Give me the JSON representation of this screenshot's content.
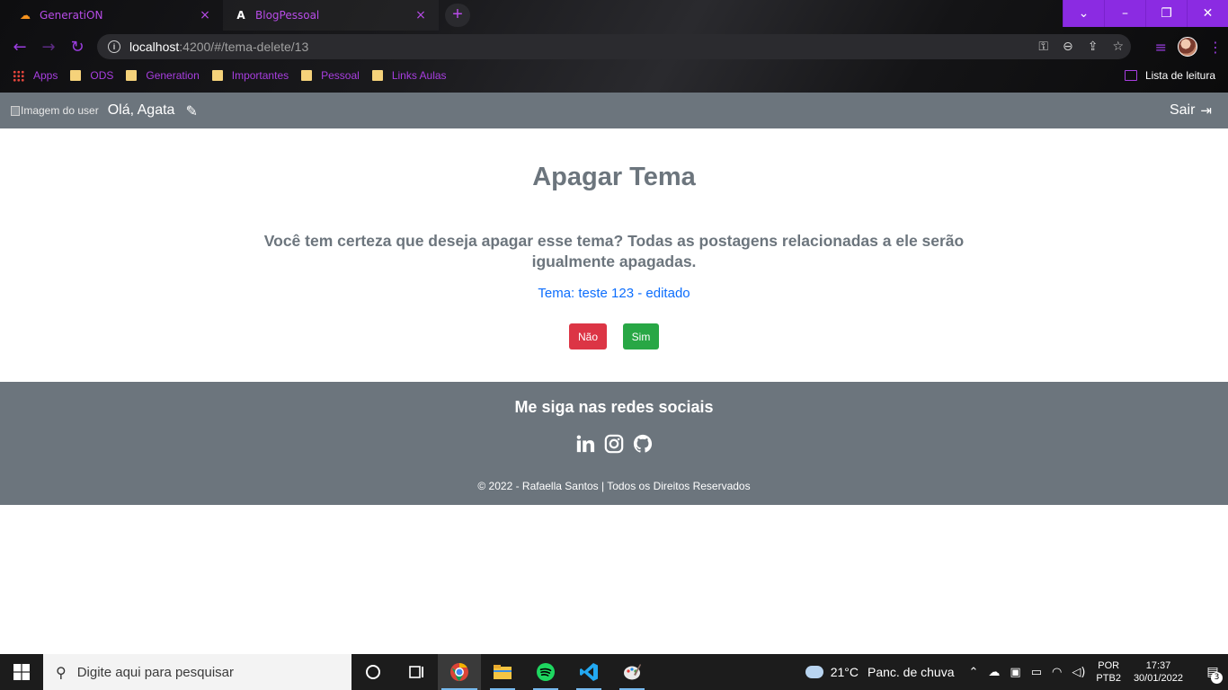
{
  "browser": {
    "tabs": [
      {
        "title": "GeneratiON",
        "icon": "cloud-icon"
      },
      {
        "title": "BlogPessoal",
        "icon": "angular-icon"
      }
    ],
    "tab_close": "×",
    "new_tab": "+",
    "window_buttons": {
      "tab_search": "⌄",
      "minimize": "–",
      "restore": "❐",
      "close": "✕"
    },
    "url": {
      "host": "localhost",
      "rest": ":4200/#/tema-delete/13"
    },
    "bookmarks": [
      "Apps",
      "ODS",
      "Generation",
      "Importantes",
      "Pessoal",
      "Links Aulas"
    ],
    "reading_list": "Lista de leitura",
    "accent_color": "#a83ee0"
  },
  "app_nav": {
    "user_image_alt": "Imagem do user",
    "greeting": "Olá, Agata",
    "logout_label": "Sair"
  },
  "main": {
    "title": "Apagar Tema",
    "confirm_text": "Você tem certeza que deseja apagar esse tema? Todas as postagens relacionadas a ele serão igualmente apagadas.",
    "tema_label": "Tema: teste 123 - editado",
    "no_button": "Não",
    "yes_button": "Sim",
    "colors": {
      "no": "#dc3545",
      "yes": "#28a745",
      "nav": "#6c757d",
      "link": "#0d6efd"
    }
  },
  "footer": {
    "title": "Me siga nas redes sociais",
    "socials": [
      "linkedin-icon",
      "instagram-icon",
      "github-icon"
    ],
    "copyright": "© 2022 - Rafaella Santos | Todos os Direitos Reservados"
  },
  "taskbar": {
    "search_placeholder": "Digite aqui para pesquisar",
    "weather_temp": "21°C",
    "weather_desc": "Panc. de chuva",
    "lang_line1": "POR",
    "lang_line2": "PTB2",
    "time": "17:37",
    "date": "30/01/2022",
    "notifications": "3"
  }
}
